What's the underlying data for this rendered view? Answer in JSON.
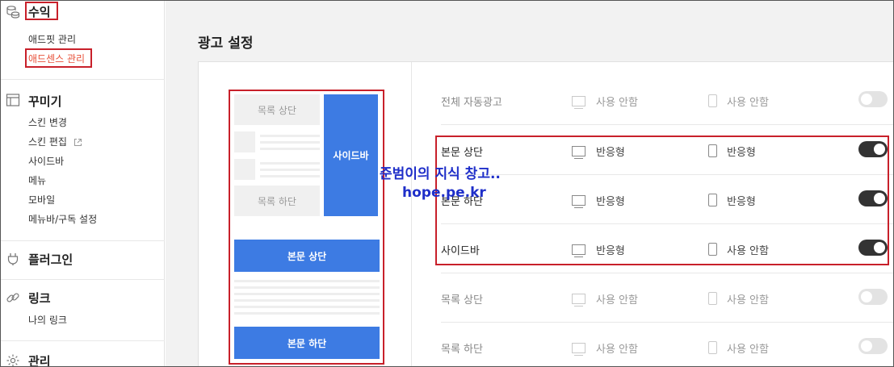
{
  "sidebar": {
    "revenue": {
      "title": "수익",
      "icon": "coins-icon",
      "items": [
        "애드핏 관리",
        "애드센스 관리"
      ]
    },
    "decorate": {
      "title": "꾸미기",
      "icon": "layout-icon",
      "items": [
        "스킨 변경",
        "스킨 편집",
        "사이드바",
        "메뉴",
        "모바일",
        "메뉴바/구독 설정"
      ]
    },
    "plugin": {
      "title": "플러그인",
      "icon": "plug-icon"
    },
    "link": {
      "title": "링크",
      "icon": "link-icon",
      "items": [
        "나의 링크"
      ]
    },
    "manage": {
      "title": "관리",
      "icon": "gear-icon"
    }
  },
  "main": {
    "title": "광고 설정",
    "preview": {
      "list_top": "목록 상단",
      "sidebar": "사이드바",
      "list_bottom": "목록 하단",
      "body_top": "본문 상단",
      "body_bottom": "본문 하단"
    },
    "rows": [
      {
        "label": "전체 자동광고",
        "pc": "사용 안함",
        "mobile": "사용 안함",
        "enabled": false
      },
      {
        "label": "본문 상단",
        "pc": "반응형",
        "mobile": "반응형",
        "enabled": true
      },
      {
        "label": "본문 하단",
        "pc": "반응형",
        "mobile": "반응형",
        "enabled": true
      },
      {
        "label": "사이드바",
        "pc": "반응형",
        "mobile": "사용 안함",
        "enabled": true
      },
      {
        "label": "목록 상단",
        "pc": "사용 안함",
        "mobile": "사용 안함",
        "enabled": false
      },
      {
        "label": "목록 하단",
        "pc": "사용 안함",
        "mobile": "사용 안함",
        "enabled": false
      }
    ]
  },
  "watermark": {
    "line1": "준범이의 지식 창고..",
    "line2": "hope.pe.kr"
  },
  "colors": {
    "highlight": "#c8202a",
    "accent": "#3d7be3",
    "active_link": "#e8513a",
    "toggle_on": "#333333"
  }
}
